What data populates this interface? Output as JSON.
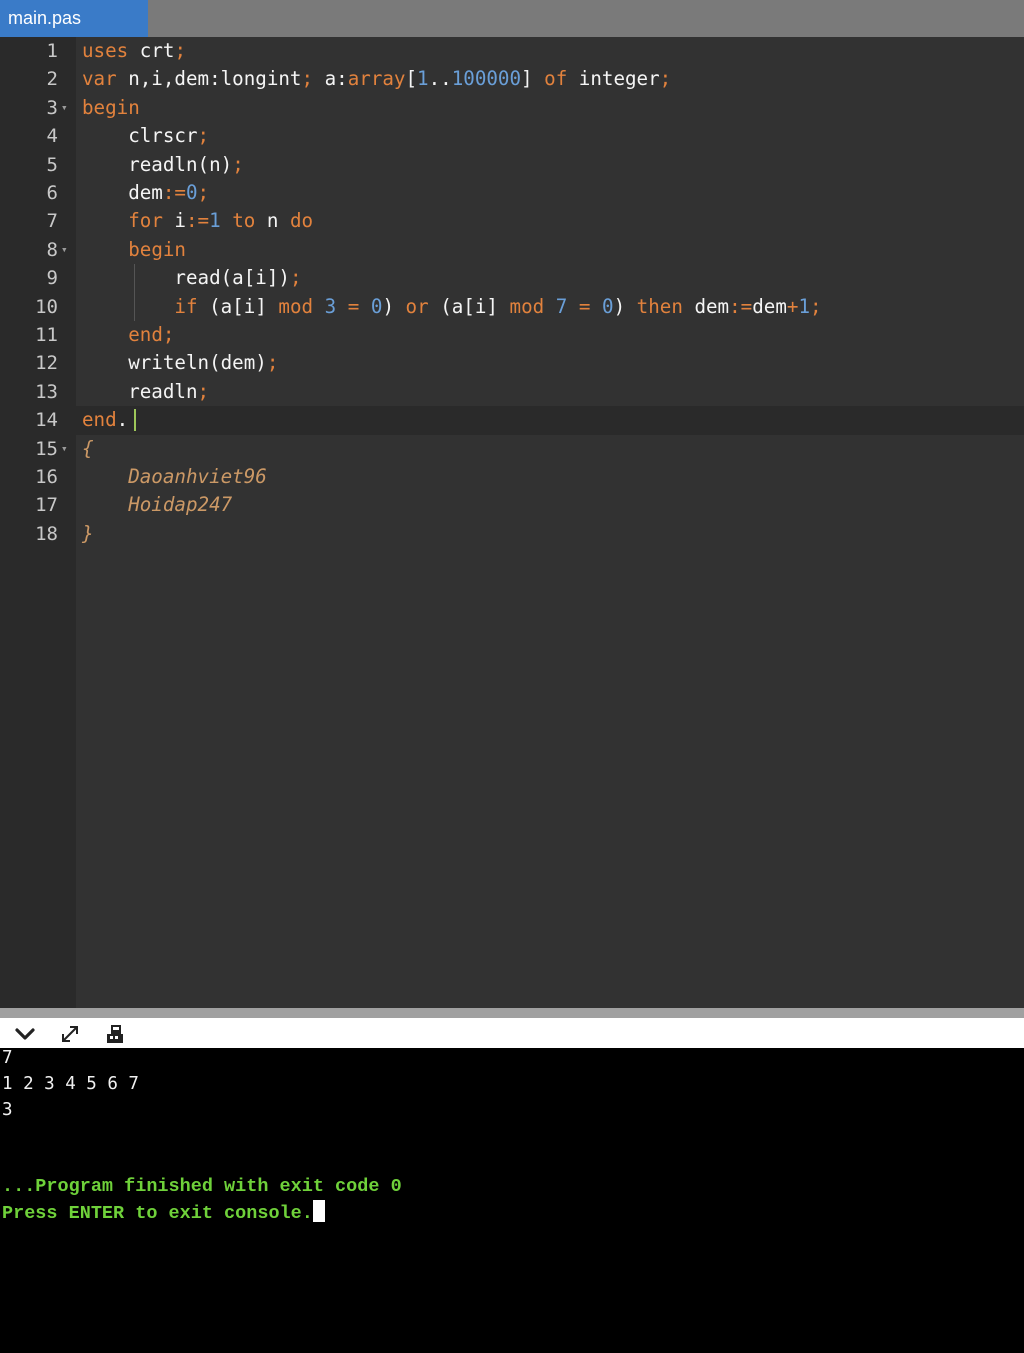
{
  "tab": {
    "label": "main.pas"
  },
  "editor": {
    "line_numbers": [
      "1",
      "2",
      "3",
      "4",
      "5",
      "6",
      "7",
      "8",
      "9",
      "10",
      "11",
      "12",
      "13",
      "14",
      "15",
      "16",
      "17",
      "18"
    ],
    "active_line": "14"
  },
  "toolbar": {
    "collapse_icon": "chevron-down-icon",
    "expand_icon": "expand-icon",
    "stdin_icon": "stdin-icon"
  },
  "console": {
    "lines": [
      "7",
      "1 2 3 4 5 6 7",
      "3"
    ],
    "finished_message": "...Program finished with exit code 0",
    "exit_prompt": "Press ENTER to exit console."
  },
  "colors": {
    "keyword": "#e2823d",
    "number": "#6a9fd8",
    "comment": "#cc9966",
    "console_status": "#6fd13a",
    "tab_active": "#3a7bc8"
  }
}
